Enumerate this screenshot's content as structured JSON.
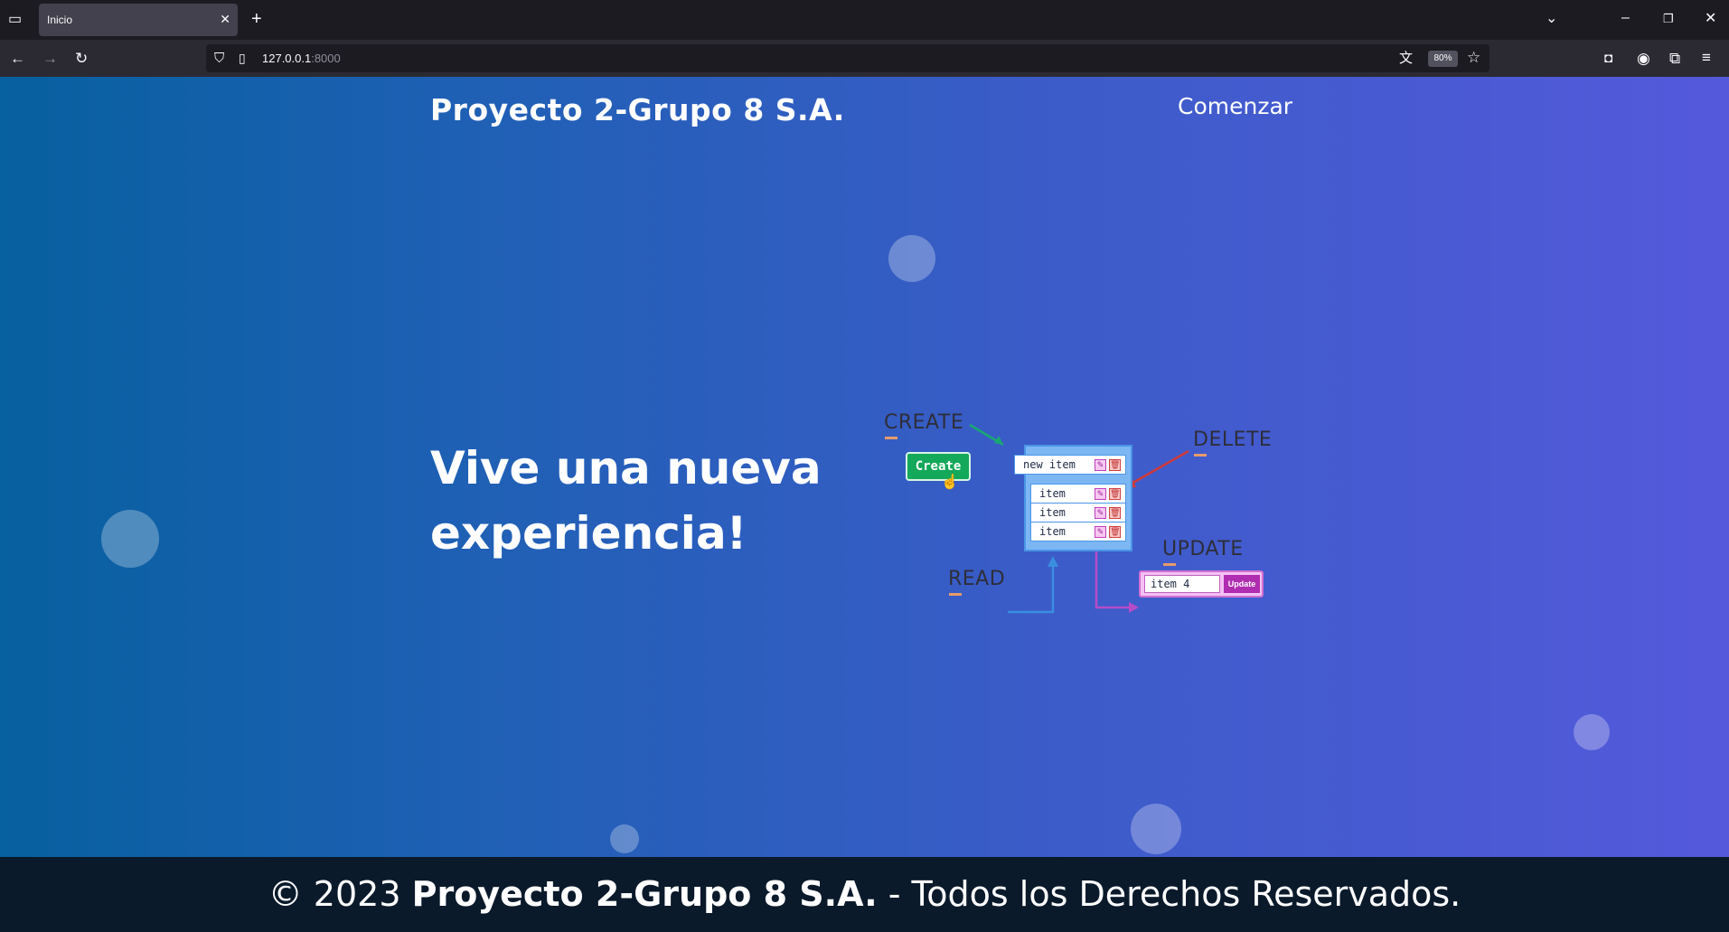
{
  "browser": {
    "tab_title": "Inicio",
    "url_host": "127.0.0.1",
    "url_port": ":8000",
    "zoom": "80%"
  },
  "page": {
    "brand": "Proyecto 2-Grupo 8 S.A.",
    "nav_link": "Comenzar",
    "hero_line1": "Vive una nueva",
    "hero_line2": "experiencia!"
  },
  "illustration": {
    "create_label": "CREATE",
    "delete_label": "DELETE",
    "update_label": "UPDATE",
    "read_label": "READ",
    "create_button": "Create",
    "new_item": "new item",
    "items": [
      "item",
      "item",
      "item"
    ],
    "update_input": "item 4",
    "update_button": "Update"
  },
  "footer": {
    "copyright": "© 2023",
    "company": "Proyecto 2-Grupo 8 S.A.",
    "rights": "- Todos los Derechos Reservados."
  }
}
